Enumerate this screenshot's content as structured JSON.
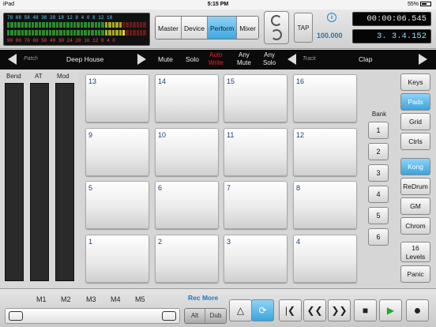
{
  "status": {
    "device": "iPad",
    "time": "5:15 PM",
    "battery": "55%"
  },
  "meter": {
    "top_scale": [
      "78",
      "68",
      "58",
      "48",
      "38",
      "28",
      "18",
      "12",
      "8",
      "4",
      "0",
      "8",
      "12",
      "18"
    ],
    "bottom_scale": [
      "90",
      "80",
      "70",
      "60",
      "50",
      "40",
      "30",
      "24",
      "20",
      "16",
      "12",
      "8",
      "4",
      "0"
    ]
  },
  "modes": [
    {
      "label": "Master",
      "active": false
    },
    {
      "label": "Device",
      "active": false
    },
    {
      "label": "Perform",
      "active": true
    },
    {
      "label": "Mixer",
      "active": false
    }
  ],
  "tap_label": "TAP",
  "tempo": "100.000",
  "time_display": "00:00:06.545",
  "position_display": "3. 3.4.152",
  "nav": {
    "patch_caption": "Patch",
    "patch_name": "Deep House",
    "mute": "Mute",
    "solo": "Solo",
    "auto_write": [
      "Auto",
      "Write"
    ],
    "any_mute": [
      "Any",
      "Mute"
    ],
    "any_solo": [
      "Any",
      "Solo"
    ],
    "track_caption": "Track",
    "track_name": "Clap"
  },
  "strips": [
    "Bend",
    "AT",
    "Mod"
  ],
  "pads": [
    "13",
    "14",
    "15",
    "16",
    "9",
    "10",
    "11",
    "12",
    "5",
    "6",
    "7",
    "8",
    "1",
    "2",
    "3",
    "4"
  ],
  "bank": {
    "label": "Bank",
    "buttons": [
      "1",
      "2",
      "3",
      "4",
      "5",
      "6"
    ]
  },
  "right_buttons": {
    "group1": [
      {
        "label": "Keys",
        "active": false
      },
      {
        "label": "Pads",
        "active": true
      },
      {
        "label": "Grid",
        "active": false
      },
      {
        "label": "Ctrls",
        "active": false
      }
    ],
    "group2": [
      {
        "label": "Kong",
        "active": true
      },
      {
        "label": "ReDrum",
        "active": false
      },
      {
        "label": "GM",
        "active": false
      },
      {
        "label": "Chrom",
        "active": false
      }
    ],
    "levels": [
      "16",
      "Levels"
    ],
    "panic": "Panic"
  },
  "bottom": {
    "macros": [
      "M1",
      "M2",
      "M3",
      "M4",
      "M5"
    ],
    "rec_more": "Rec More",
    "alt": "Alt",
    "dub": "Dub"
  },
  "colors": {
    "accent": "#3aa4dd",
    "red": "#e8262a",
    "link": "#1e77bb",
    "play": "#22aa22"
  }
}
